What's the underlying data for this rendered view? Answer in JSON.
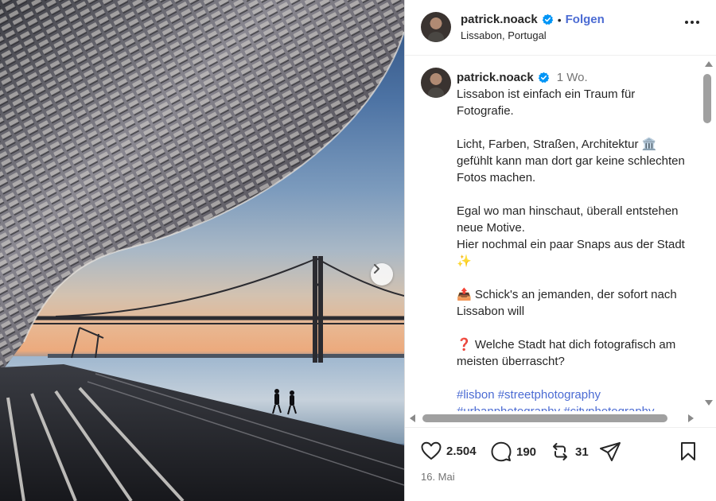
{
  "photo": {
    "alt_icon": "landscape-photo",
    "next_icon": "chevron-right-icon"
  },
  "header": {
    "username": "patrick.noack",
    "separator": "•",
    "follow_label": "Folgen",
    "location": "Lissabon, Portugal",
    "more_icon": "more-horizontal-icon"
  },
  "caption": {
    "username": "patrick.noack",
    "time": "1 Wo.",
    "paragraphs": [
      "Lissabon ist einfach ein Traum für Fotografie.",
      "Licht, Farben, Straßen, Architektur 🏛️ gefühlt kann man dort gar keine schlechten Fotos machen.",
      "Egal wo man hinschaut, überall entstehen neue Motive.\nHier nochmal ein paar Snaps aus der Stadt ✨",
      "📤 Schick's an jemanden, der sofort nach Lissabon will",
      "❓ Welche Stadt hat dich fotografisch am meisten überrascht?"
    ],
    "hashtags": "#lisbon #streetphotography #urbanphotography #cityphotography"
  },
  "actions": {
    "likes": "2.504",
    "comments": "190",
    "reposts": "31",
    "date": "16. Mai"
  },
  "colors": {
    "accent": "#4b6bd3",
    "verified": "#0095f6",
    "text": "#262626",
    "muted": "#737373"
  }
}
